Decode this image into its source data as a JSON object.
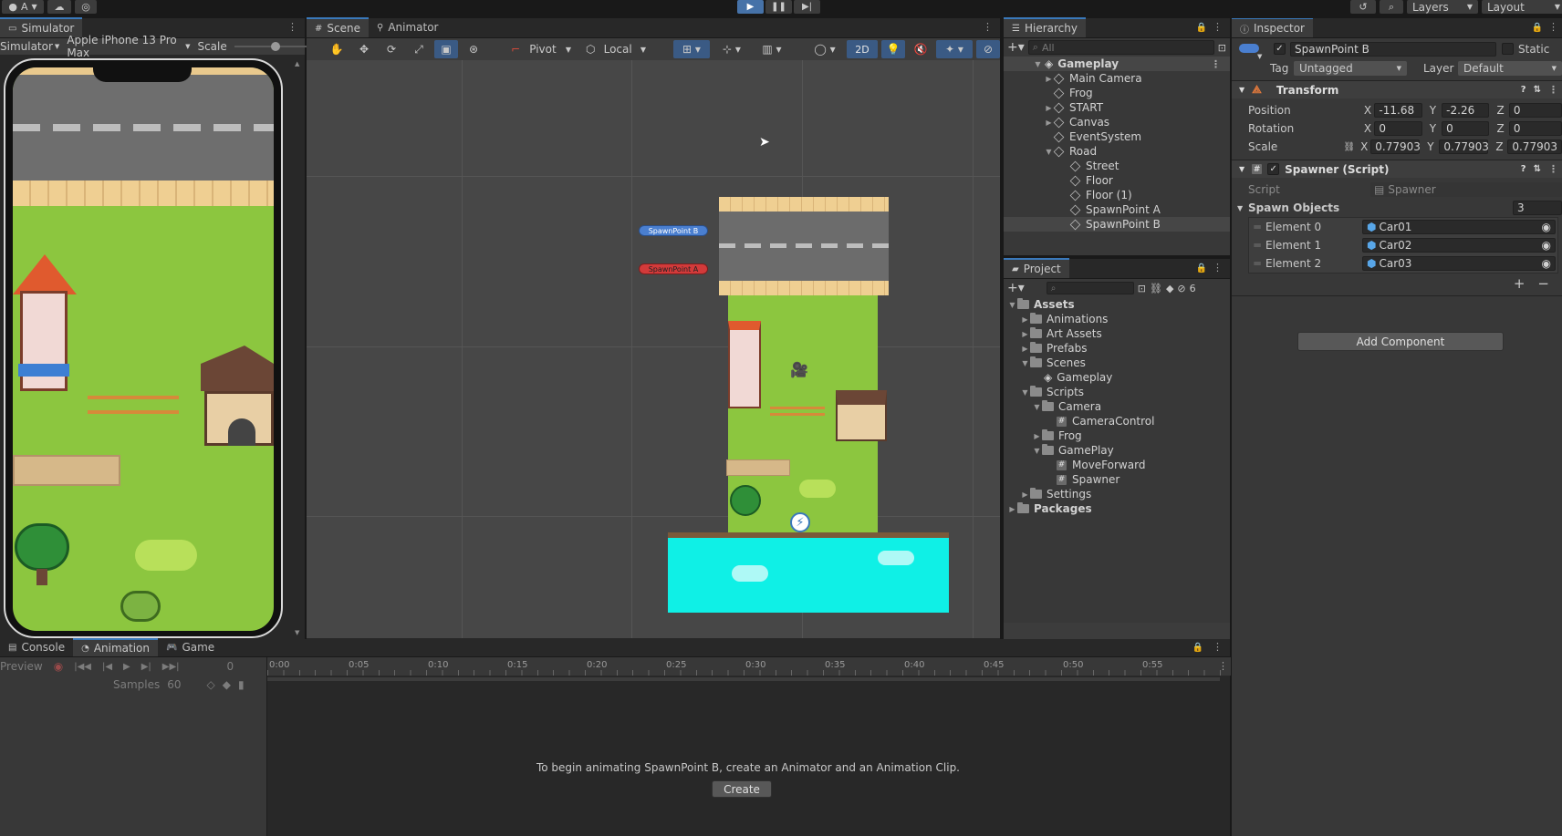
{
  "topbar": {
    "account_label": "A",
    "layers_label": "Layers",
    "layout_label": "Layout"
  },
  "simulator": {
    "tab": "Simulator",
    "mode": "Simulator",
    "device": "Apple iPhone 13 Pro Max",
    "scale_label": "Scale"
  },
  "scene": {
    "tabs": [
      "Scene",
      "Animator"
    ],
    "pivot_label": "Pivot",
    "local_label": "Local",
    "mode_2d_label": "2D",
    "spawn_b_label": "SpawnPoint B",
    "spawn_a_label": "SpawnPoint A"
  },
  "hierarchy": {
    "tab": "Hierarchy",
    "search_placeholder": "All",
    "items": [
      {
        "label": "Gameplay"
      },
      {
        "label": "Main Camera"
      },
      {
        "label": "Frog"
      },
      {
        "label": "START"
      },
      {
        "label": "Canvas"
      },
      {
        "label": "EventSystem"
      },
      {
        "label": "Road"
      },
      {
        "label": "Street"
      },
      {
        "label": "Floor"
      },
      {
        "label": "Floor (1)"
      },
      {
        "label": "SpawnPoint A"
      },
      {
        "label": "SpawnPoint B"
      }
    ]
  },
  "project": {
    "tab": "Project",
    "hidden_count": "6",
    "items": [
      {
        "label": "Assets"
      },
      {
        "label": "Animations"
      },
      {
        "label": "Art Assets"
      },
      {
        "label": "Prefabs"
      },
      {
        "label": "Scenes"
      },
      {
        "label": "Gameplay"
      },
      {
        "label": "Scripts"
      },
      {
        "label": "Camera"
      },
      {
        "label": "CameraControl"
      },
      {
        "label": "Frog"
      },
      {
        "label": "GamePlay"
      },
      {
        "label": "MoveForward"
      },
      {
        "label": "Spawner"
      },
      {
        "label": "Settings"
      },
      {
        "label": "Packages"
      }
    ]
  },
  "inspector": {
    "tab": "Inspector",
    "object_name": "SpawnPoint B",
    "static_label": "Static",
    "tag_label": "Tag",
    "tag_value": "Untagged",
    "layer_label": "Layer",
    "layer_value": "Default",
    "transform": {
      "title": "Transform",
      "position_label": "Position",
      "rotation_label": "Rotation",
      "scale_label": "Scale",
      "axis_x": "X",
      "axis_y": "Y",
      "axis_z": "Z",
      "position": [
        "-11.68",
        "-2.26",
        "0"
      ],
      "rotation": [
        "0",
        "0",
        "0"
      ],
      "scale": [
        "0.77903",
        "0.77903",
        "0.77903"
      ]
    },
    "spawner": {
      "title": "Spawner (Script)",
      "script_label": "Script",
      "script_value": "Spawner",
      "spawn_objects_label": "Spawn Objects",
      "spawn_objects_count": "3",
      "elements": [
        {
          "label": "Element 0",
          "value": "Car01"
        },
        {
          "label": "Element 1",
          "value": "Car02"
        },
        {
          "label": "Element 2",
          "value": "Car03"
        }
      ]
    },
    "add_component_label": "Add Component"
  },
  "bottom": {
    "tabs": [
      "Console",
      "Animation",
      "Game"
    ],
    "preview_label": "Preview",
    "frame_value": "0",
    "samples_label": "Samples",
    "samples_value": "60",
    "timeline_ticks": [
      "0:00",
      "0:05",
      "0:10",
      "0:15",
      "0:20",
      "0:25",
      "0:30",
      "0:35",
      "0:40",
      "0:45",
      "0:50",
      "0:55"
    ],
    "message": "To begin animating SpawnPoint B, create an Animator and an Animation Clip.",
    "create_label": "Create"
  }
}
